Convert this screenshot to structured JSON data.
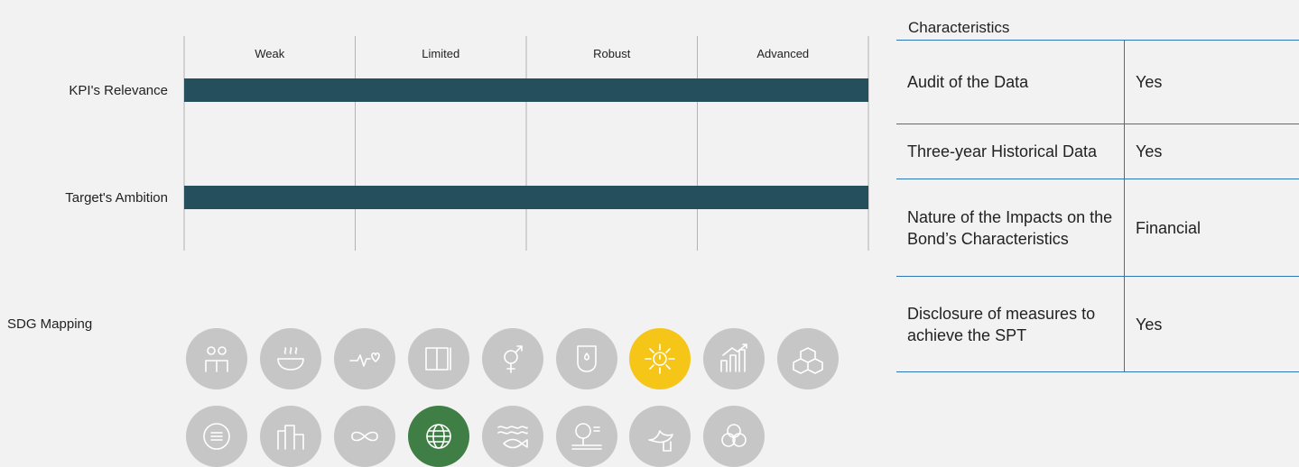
{
  "chart_data": {
    "type": "bar",
    "orientation": "horizontal",
    "scale": [
      "Weak",
      "Limited",
      "Robust",
      "Advanced"
    ],
    "categories": [
      "KPI's Relevance",
      "Target's Ambition"
    ],
    "values": [
      "Advanced",
      "Advanced"
    ],
    "colors": {
      "bar": "#264f5e",
      "gridline": "#b3b3b3"
    }
  },
  "sdg": {
    "label": "SDG Mapping",
    "icons": [
      {
        "name": "no-poverty-icon",
        "active": false
      },
      {
        "name": "zero-hunger-icon",
        "active": false
      },
      {
        "name": "good-health-icon",
        "active": false
      },
      {
        "name": "quality-education-icon",
        "active": false
      },
      {
        "name": "gender-equality-icon",
        "active": false
      },
      {
        "name": "clean-water-icon",
        "active": false
      },
      {
        "name": "affordable-clean-energy-icon",
        "active": true,
        "color": "#f5c518"
      },
      {
        "name": "decent-work-icon",
        "active": false
      },
      {
        "name": "industry-innovation-icon",
        "active": false
      },
      {
        "name": "reduced-inequalities-icon",
        "active": false
      },
      {
        "name": "sustainable-cities-icon",
        "active": false
      },
      {
        "name": "responsible-consumption-icon",
        "active": false
      },
      {
        "name": "climate-action-icon",
        "active": true,
        "color": "#3f7e44"
      },
      {
        "name": "life-below-water-icon",
        "active": false
      },
      {
        "name": "life-on-land-icon",
        "active": false
      },
      {
        "name": "peace-justice-icon",
        "active": false
      },
      {
        "name": "partnerships-icon",
        "active": false
      }
    ]
  },
  "characteristics": {
    "title": "Characteristics",
    "rows": [
      {
        "label": "Audit of the Data",
        "value": "Yes"
      },
      {
        "label": "Three-year Historical Data",
        "value": "Yes"
      },
      {
        "label": "Nature of the Impacts on the Bond’s Characteristics",
        "value": "Financial"
      },
      {
        "label": "Disclosure of measures to achieve the SPT",
        "value": "Yes"
      }
    ]
  }
}
